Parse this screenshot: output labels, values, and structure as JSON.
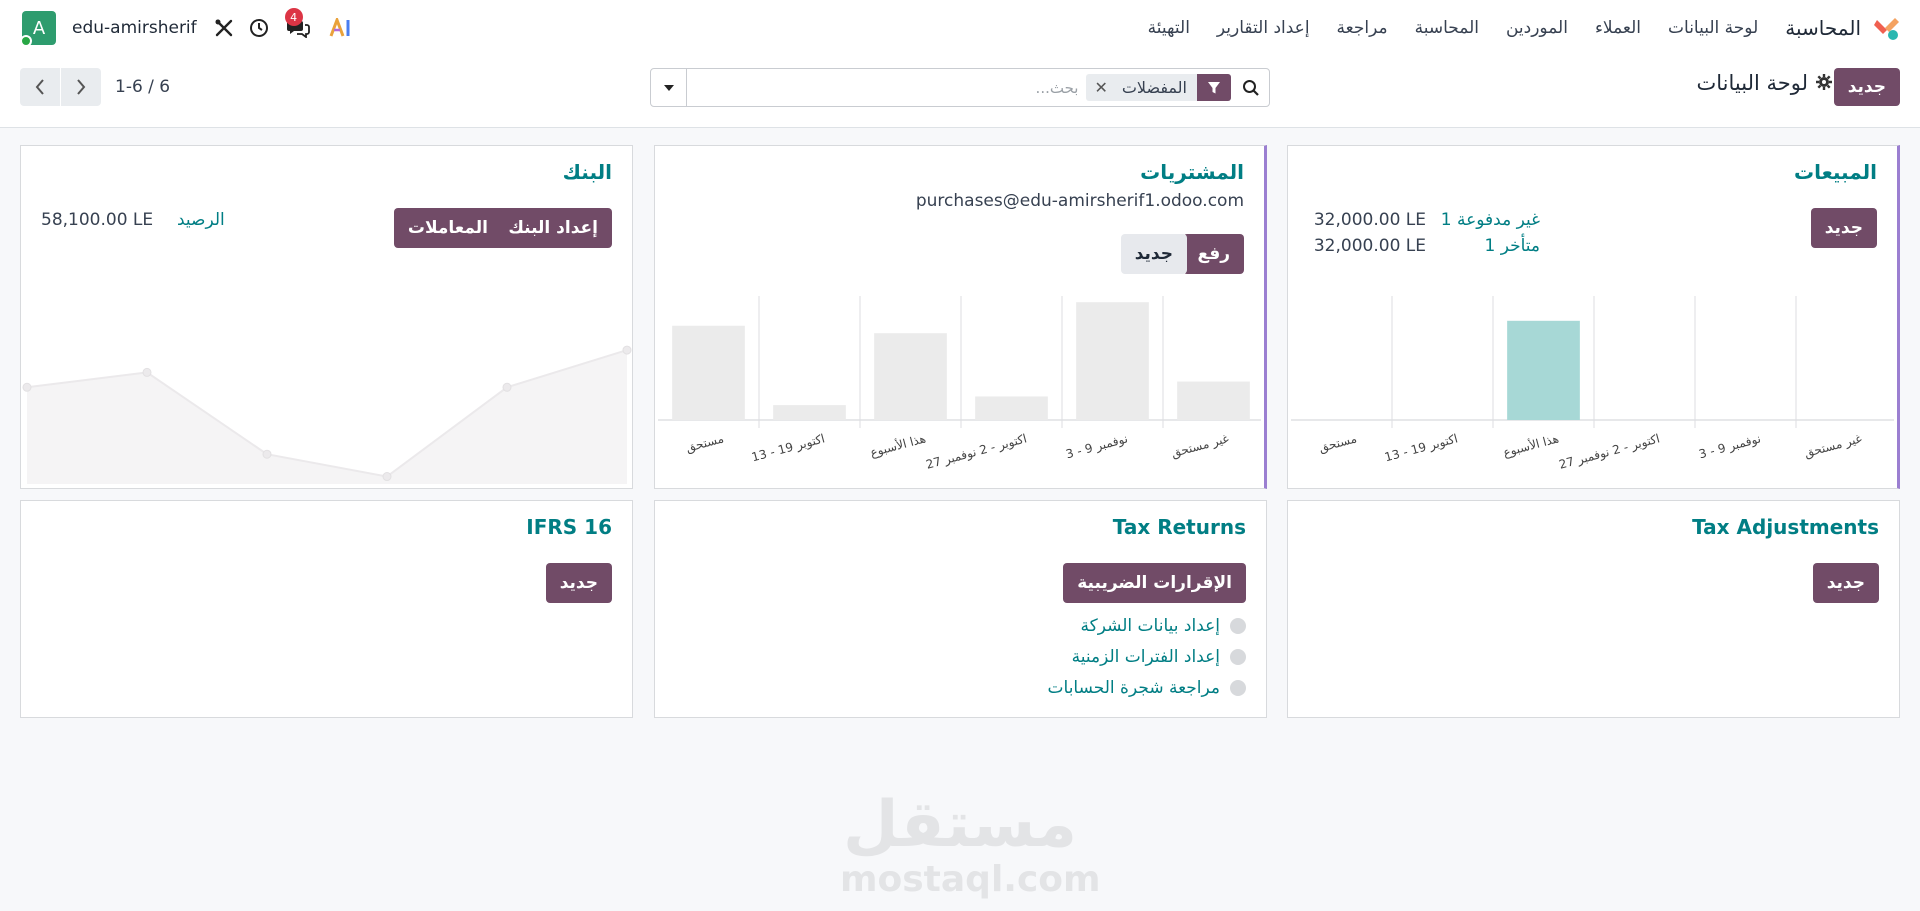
{
  "navbar": {
    "app_title": "المحاسبة",
    "menu": [
      "لوحة البيانات",
      "العملاء",
      "الموردين",
      "المحاسبة",
      "مراجعة",
      "إعداد التقارير",
      "التهيئة"
    ],
    "user_name": "edu-amirsherif",
    "avatar_letter": "A",
    "messages_count": "4"
  },
  "control": {
    "new_label": "جديد",
    "page_title": "لوحة البيانات",
    "search_placeholder": "بحث...",
    "facet_label": "المفضلات",
    "pager_value": "1-6 / 6"
  },
  "cards": {
    "sales": {
      "title": "المبيعات",
      "new_label": "جديد",
      "stat1_label": "1 غير مدفوعة",
      "stat1_value": "32,000.00 LE",
      "stat2_label": "1 متأخر",
      "stat2_value": "32,000.00 LE",
      "bar_color": "#a7d8d6"
    },
    "purchases": {
      "title": "المشتريات",
      "email": "purchases@edu-amirsherif1.odoo.com",
      "upload_label": "رفع",
      "new_label": "جديد",
      "bar_color": "#ebebeb"
    },
    "bank": {
      "title": "البنك",
      "setup_label": "إعداد البنك",
      "transactions_label": "المعاملات",
      "balance_label": "الرصيد",
      "balance_value": "58,100.00 LE"
    },
    "tax_adjustments": {
      "title": "Tax Adjustments",
      "new_label": "جديد"
    },
    "tax_returns": {
      "title": "Tax Returns",
      "button_label": "الإقرارات الضريبية",
      "checklist": [
        "إعداد بيانات الشركة",
        "إعداد الفترات الزمنية",
        "مراجعة شجرة الحسابات"
      ]
    },
    "ifrs16": {
      "title": "IFRS 16",
      "new_label": "جديد"
    }
  },
  "chart_data": [
    {
      "type": "bar",
      "categories": [
        "مستحق",
        "13 - 19 اكتوبر",
        "هذا الأسبوع",
        "27 اكتوبر - 2 نوفمبر",
        "3 - 9 نوفمبر",
        "غير مستحق"
      ],
      "values": [
        0,
        0,
        32000,
        0,
        0,
        0
      ],
      "ylim": [
        0,
        40000
      ]
    },
    {
      "type": "bar",
      "categories": [
        "مستحق",
        "13 - 19 اكتوبر",
        "هذا الأسبوع",
        "27 اكتوبر - 2 نوفمبر",
        "3 - 9 نوفمبر",
        "غير مستحق"
      ],
      "values": [
        76,
        12,
        70,
        19,
        95,
        31
      ],
      "ylim": [
        0,
        100
      ]
    },
    {
      "type": "area",
      "x": [
        1,
        2,
        3,
        4,
        5,
        6
      ],
      "values": [
        52,
        60,
        16,
        4,
        52,
        72
      ],
      "ylim": [
        0,
        100
      ]
    }
  ],
  "watermark": {
    "arabic": "مستقل",
    "latin": "mostaql.com"
  }
}
